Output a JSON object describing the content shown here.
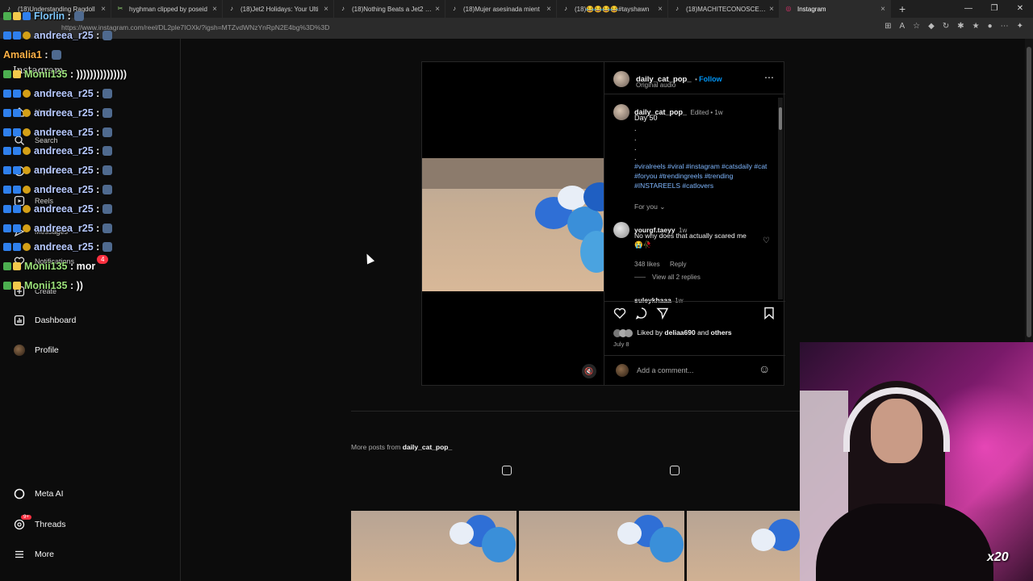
{
  "browser": {
    "tabs": [
      {
        "title": "(18)Understanding Ragdoll",
        "icon": "tiktok-icon"
      },
      {
        "title": "hyghman clipped by poseid",
        "icon": "twitch-clip-icon"
      },
      {
        "title": "(18)Jet2 Holidays: Your Ulti",
        "icon": "tiktok-icon"
      },
      {
        "title": "(18)Nothing Beats a Jet2 Ho",
        "icon": "tiktok-icon"
      },
      {
        "title": "(18)Mujer asesinada mient",
        "icon": "tiktok-icon"
      },
      {
        "title": "(18)😂😂😂😂#tayshawn",
        "icon": "tiktok-icon"
      },
      {
        "title": "(18)MACHITECONOSCE (@",
        "icon": "tiktok-icon"
      },
      {
        "title": "Instagram",
        "icon": "instagram-icon",
        "active": true
      }
    ],
    "url": "https://www.instagram.com/reel/DL2ple7IOXk/?igsh=MTZvdWNzYnRpN2E4bg%3D%3D"
  },
  "sidebar": {
    "logo": "Instagram",
    "items": [
      {
        "label": "Home",
        "icon": "home-icon"
      },
      {
        "label": "Search",
        "icon": "search-icon"
      },
      {
        "label": "Explore",
        "icon": "explore-icon"
      },
      {
        "label": "Reels",
        "icon": "reels-icon"
      },
      {
        "label": "Messages",
        "icon": "messages-icon"
      },
      {
        "label": "Notifications",
        "icon": "heart-icon"
      },
      {
        "label": "Create",
        "icon": "create-icon"
      },
      {
        "label": "Dashboard",
        "icon": "dashboard-icon"
      },
      {
        "label": "Profile",
        "icon": "profile-icon"
      },
      {
        "label": "Meta AI",
        "icon": "meta-ai-icon"
      },
      {
        "label": "Threads",
        "icon": "threads-icon"
      },
      {
        "label": "More",
        "icon": "menu-icon"
      }
    ],
    "notifications_badge": "4",
    "threads_badge": "9+"
  },
  "chat": [
    {
      "user": "Florlin",
      "text": "",
      "color": "#7ec8ff"
    },
    {
      "user": "andreea_r25",
      "text": "",
      "color": "#b7c9ff"
    },
    {
      "user": "Amalia1",
      "text": "",
      "color": "#ffb347"
    },
    {
      "user": "Monii135",
      "text": ")))))))))))))))",
      "color": "#9be07a"
    },
    {
      "user": "andreea_r25",
      "text": "",
      "color": "#b7c9ff"
    },
    {
      "user": "andreea_r25",
      "text": "",
      "color": "#b7c9ff"
    },
    {
      "user": "andreea_r25",
      "text": "",
      "color": "#b7c9ff"
    },
    {
      "user": "andreea_r25",
      "text": "",
      "color": "#b7c9ff"
    },
    {
      "user": "andreea_r25",
      "text": "",
      "color": "#b7c9ff"
    },
    {
      "user": "andreea_r25",
      "text": "",
      "color": "#b7c9ff"
    },
    {
      "user": "andreea_r25",
      "text": "",
      "color": "#b7c9ff"
    },
    {
      "user": "andreea_r25",
      "text": "",
      "color": "#b7c9ff"
    },
    {
      "user": "andreea_r25",
      "text": "",
      "color": "#b7c9ff"
    },
    {
      "user": "Monii135",
      "text": "mor",
      "color": "#9be07a"
    },
    {
      "user": "Monii135",
      "text": "))",
      "color": "#9be07a"
    }
  ],
  "post": {
    "author": "daily_cat_pop_",
    "follow_label": "Follow",
    "audio": "Original audio",
    "caption": {
      "author": "daily_cat_pop_",
      "meta": "Edited • 1w",
      "text": "Day 50",
      "dots": [
        ".",
        ".",
        ".",
        "."
      ],
      "hashtags": "#viralreels #viral #instagram #catsdaily #cat #foryou #trendingreels #trending #INSTAREELS #catlovers"
    },
    "for_you": "For you",
    "comments": [
      {
        "user": "yourgf.taeyy",
        "age": "1w",
        "text": "No why does that actually scared me😭🥀",
        "likes": "348 likes",
        "reply": "Reply",
        "view_replies": "View all 2 replies"
      },
      {
        "user": "suleykhaaa",
        "age": "1w"
      }
    ],
    "liked_by_prefix": "Liked by",
    "liked_by_user": "deliaa690",
    "liked_by_and": "and",
    "liked_by_others": "others",
    "date": "July 8",
    "add_comment_placeholder": "Add a comment..."
  },
  "more_posts": {
    "prefix": "More posts from",
    "author": "daily_cat_pop_"
  },
  "overlay": {
    "multiplier": "x20"
  },
  "colors": {
    "accent": "#0095f6",
    "badge": "#ff3040",
    "background": "#0c0c0c"
  }
}
